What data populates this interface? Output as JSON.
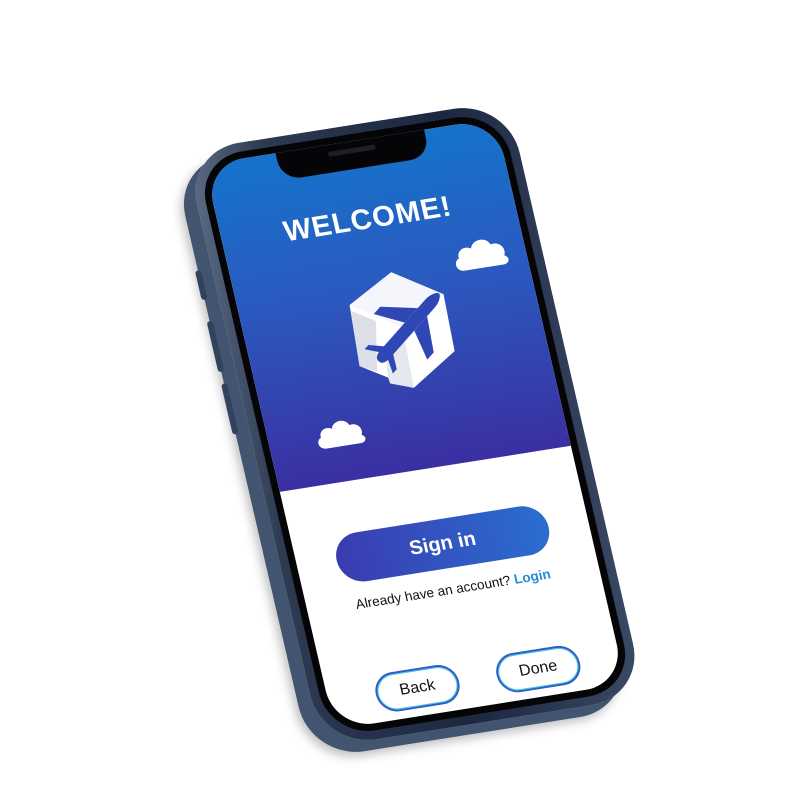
{
  "screen": {
    "title": "WELCOME!",
    "logo_icon": "cube-airplane-logo",
    "cloud_icon": "cloud-icon"
  },
  "auth": {
    "sign_in_label": "Sign in",
    "account_prompt": "Already have an account?",
    "login_link": "Login"
  },
  "nav": {
    "back_label": "Back",
    "done_label": "Done"
  },
  "colors": {
    "gradient_top": "#1573cb",
    "gradient_bottom": "#3a2fa2",
    "button_start": "#3b3bb0",
    "button_end": "#2a6ed0",
    "link": "#1f8fd8",
    "phone_frame": "#2d3a52"
  }
}
